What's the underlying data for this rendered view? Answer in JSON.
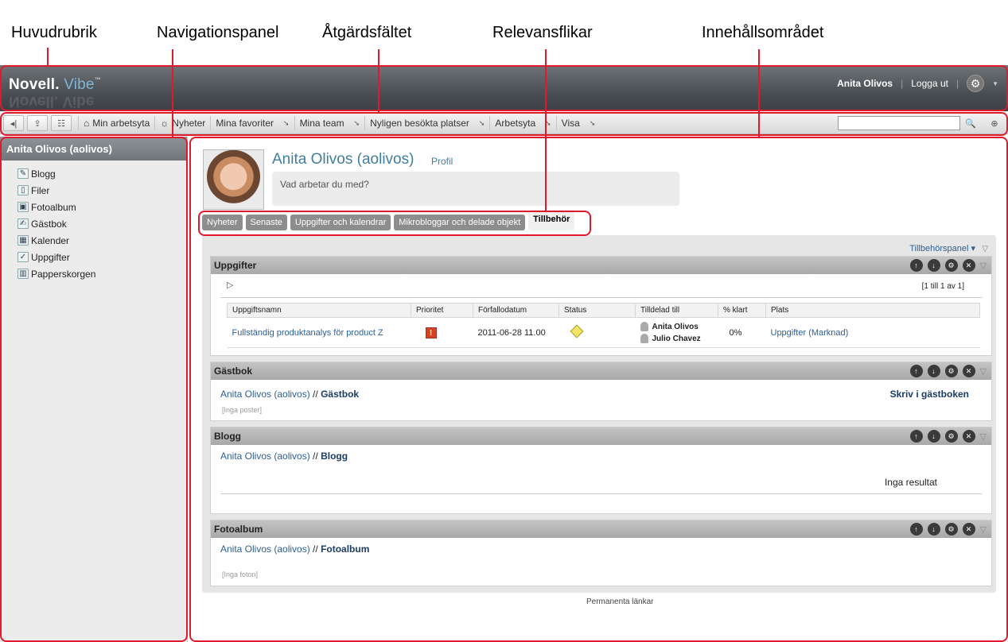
{
  "callouts": [
    "Huvudrubrik",
    "Navigationspanel",
    "Åtgärdsfältet",
    "Relevansflikar",
    "Innehållsområdet"
  ],
  "header": {
    "logo_brand": "Novell.",
    "logo_product": "Vibe",
    "logo_tm": "™",
    "user": "Anita Olivos",
    "logout": "Logga ut"
  },
  "actionbar": {
    "items": [
      {
        "label": "Min arbetsyta",
        "menu": false
      },
      {
        "label": "Nyheter",
        "menu": false
      },
      {
        "label": "Mina favoriter",
        "menu": true
      },
      {
        "label": "Mina team",
        "menu": true
      },
      {
        "label": "Nyligen besökta platser",
        "menu": true
      },
      {
        "label": "Arbetsyta",
        "menu": true
      },
      {
        "label": "Visa",
        "menu": true
      }
    ],
    "search_value": ""
  },
  "nav": {
    "title": "Anita Olivos (aolivos)",
    "items": [
      "Blogg",
      "Filer",
      "Fotoalbum",
      "Gästbok",
      "Kalender",
      "Uppgifter",
      "Papperskorgen"
    ]
  },
  "profile": {
    "name": "Anita Olivos (aolivos)",
    "profile_link": "Profil",
    "status_placeholder": "Vad arbetar du med?"
  },
  "tabs": [
    "Nyheter",
    "Senaste",
    "Uppgifter och kalendrar",
    "Mikrobloggar och delade objekt",
    "Tillbehör"
  ],
  "active_tab": "Tillbehör",
  "accessory_panel": "Tillbehörspanel",
  "tasks": {
    "title": "Uppgifter",
    "paging": "[1 till 1 av 1]",
    "columns": [
      "Uppgiftsnamn",
      "Prioritet",
      "Förfallodatum",
      "Status",
      "Tilldelad till",
      "% klart",
      "Plats"
    ],
    "rows": [
      {
        "name": "Fullständig produktanalys för product Z",
        "priority": "!",
        "due": "2011-06-28 11.00",
        "assigned": [
          "Anita Olivos",
          "Julio Chavez"
        ],
        "done": "0%",
        "place": "Uppgifter (Marknad)"
      }
    ]
  },
  "guestbook": {
    "title": "Gästbok",
    "owner": "Anita Olivos (aolivos)",
    "sep": " // ",
    "section": "Gästbok",
    "sign": "Skriv i gästboken",
    "empty": "[Inga poster]"
  },
  "blog": {
    "title": "Blogg",
    "owner": "Anita Olivos (aolivos)",
    "sep": " // ",
    "section": "Blogg",
    "empty": "Inga resultat"
  },
  "photos": {
    "title": "Fotoalbum",
    "owner": "Anita Olivos (aolivos)",
    "sep": " // ",
    "section": "Fotoalbum",
    "empty": "[Inga foton]"
  },
  "permalinks": "Permanenta länkar",
  "colors": {
    "annotation": "#e0192d",
    "link": "#2d5f93",
    "header_dark": "#4a4f53"
  }
}
